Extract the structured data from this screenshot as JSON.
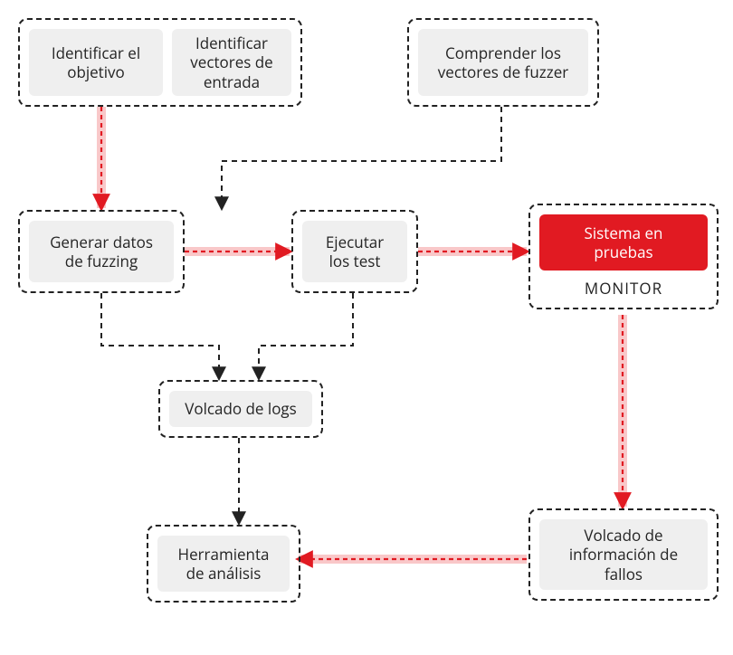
{
  "nodes": {
    "identificar_objetivo": "Identificar el\nobjetivo",
    "identificar_vectores": "Identificar\nvectores de\nentrada",
    "comprender_vectores": "Comprender los\nvectores de fuzzer",
    "generar_datos": "Generar datos\nde fuzzing",
    "ejecutar_test": "Ejecutar\nlos test",
    "sistema_pruebas": "Sistema en\npruebas",
    "monitor_label": "MONITOR",
    "volcado_logs": "Volcado de logs",
    "herramienta_analisis": "Herramienta\nde análisis",
    "volcado_fallos": "Volcado de\ninformación de\nfallos"
  },
  "colors": {
    "red_fill": "#e11a22",
    "red_band": "#f9c8c9",
    "gray_fill": "#efefef",
    "dash": "#222222"
  }
}
